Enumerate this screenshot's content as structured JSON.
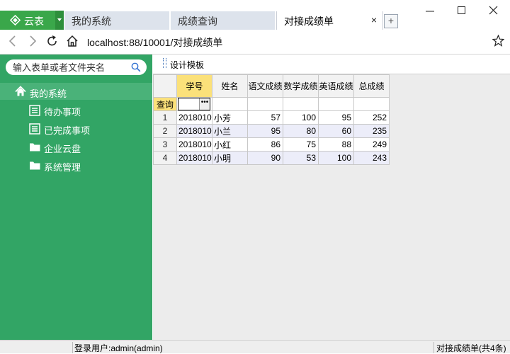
{
  "app": {
    "name": "云表",
    "brand_color": "#3aa74a"
  },
  "tabs": [
    {
      "label": "我的系统"
    },
    {
      "label": "成绩查询"
    },
    {
      "label": "对接成绩单",
      "close": "×"
    }
  ],
  "newtab": "+",
  "address": {
    "url": "localhost:88/10001/对接成绩单"
  },
  "sidebar": {
    "search_placeholder": "输入表单或者文件夹名",
    "root": {
      "label": "我的系统",
      "icon": "home-icon"
    },
    "items": [
      {
        "label": "待办事项",
        "icon": "list-icon"
      },
      {
        "label": "已完成事项",
        "icon": "list-icon"
      },
      {
        "label": "企业云盘",
        "icon": "folder-icon"
      },
      {
        "label": "系统管理",
        "icon": "folder-icon"
      }
    ],
    "bg_color": "#32a565"
  },
  "toolbar": {
    "design_label": "设计模板"
  },
  "grid": {
    "headers": [
      "学号",
      "姓名",
      "语文成绩",
      "数学成绩",
      "英语成绩",
      "总成绩"
    ],
    "query_label": "查询",
    "rows": [
      {
        "n": "1",
        "id": "2018010",
        "name": "小芳",
        "chinese": "57",
        "math": "100",
        "english": "95",
        "total": "252"
      },
      {
        "n": "2",
        "id": "2018010",
        "name": "小兰",
        "chinese": "95",
        "math": "80",
        "english": "60",
        "total": "235"
      },
      {
        "n": "3",
        "id": "2018010",
        "name": "小红",
        "chinese": "86",
        "math": "75",
        "english": "88",
        "total": "249"
      },
      {
        "n": "4",
        "id": "2018010",
        "name": "小明",
        "chinese": "90",
        "math": "53",
        "english": "100",
        "total": "243"
      }
    ]
  },
  "status": {
    "user": "登录用户:admin(admin)",
    "form_info": "对接成绩单(共4条)"
  }
}
